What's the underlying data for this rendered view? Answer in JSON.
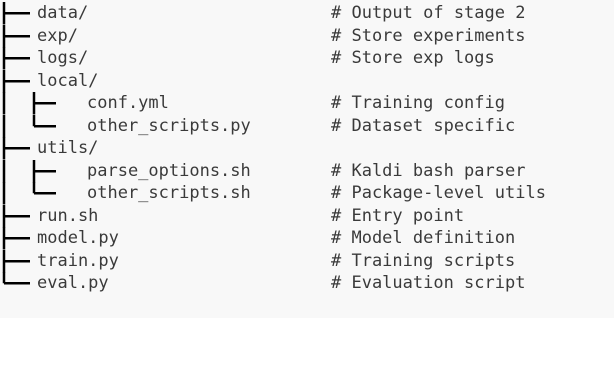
{
  "tree": {
    "rows": [
      {
        "depth": 0,
        "last": false,
        "name": "data/",
        "comment": "# Output of stage 2"
      },
      {
        "depth": 0,
        "last": false,
        "name": "exp/",
        "comment": "# Store experiments"
      },
      {
        "depth": 0,
        "last": false,
        "name": "logs/",
        "comment": "# Store exp logs"
      },
      {
        "depth": 0,
        "last": false,
        "name": "local/",
        "comment": ""
      },
      {
        "depth": 1,
        "last": false,
        "name": "conf.yml",
        "comment": "# Training config"
      },
      {
        "depth": 1,
        "last": true,
        "name": "other_scripts.py",
        "comment": "# Dataset specific"
      },
      {
        "depth": 0,
        "last": false,
        "name": "utils/",
        "comment": ""
      },
      {
        "depth": 1,
        "last": false,
        "name": "parse_options.sh",
        "comment": "# Kaldi bash parser"
      },
      {
        "depth": 1,
        "last": true,
        "name": "other_scripts.sh",
        "comment": "# Package-level utils"
      },
      {
        "depth": 0,
        "last": false,
        "name": "run.sh",
        "comment": "# Entry point"
      },
      {
        "depth": 0,
        "last": false,
        "name": "model.py",
        "comment": "# Model definition"
      },
      {
        "depth": 0,
        "last": false,
        "name": "train.py",
        "comment": "# Training scripts"
      },
      {
        "depth": 0,
        "last": true,
        "name": "eval.py",
        "comment": "# Evaluation script"
      }
    ]
  }
}
